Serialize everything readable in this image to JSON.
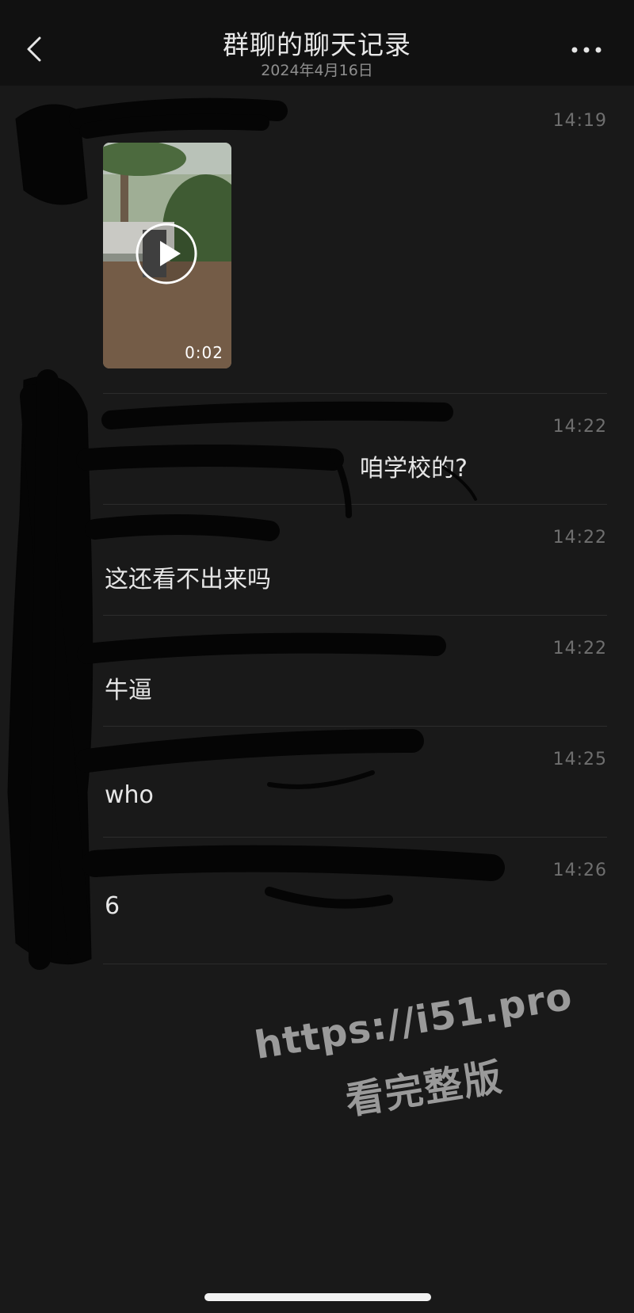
{
  "header": {
    "title": "群聊的聊天记录",
    "date": "2024年4月16日",
    "back_icon": "chevron-left-icon",
    "more_icon": "more-dots-icon"
  },
  "messages": [
    {
      "time": "14:19",
      "type": "video",
      "duration": "0:02"
    },
    {
      "time": "14:22",
      "type": "text",
      "text": "咱学校的?"
    },
    {
      "time": "14:22",
      "type": "text",
      "text": "这还看不出来吗"
    },
    {
      "time": "14:22",
      "type": "text",
      "text": "牛逼"
    },
    {
      "time": "14:25",
      "type": "text",
      "text": "who"
    },
    {
      "time": "14:26",
      "type": "text",
      "text": "6"
    }
  ],
  "watermark": {
    "url": "https://i51.pro",
    "text": "看完整版"
  },
  "colors": {
    "background": "#191919",
    "header": "#111111",
    "time": "#6f6f6f",
    "text": "#e6e6e6"
  }
}
